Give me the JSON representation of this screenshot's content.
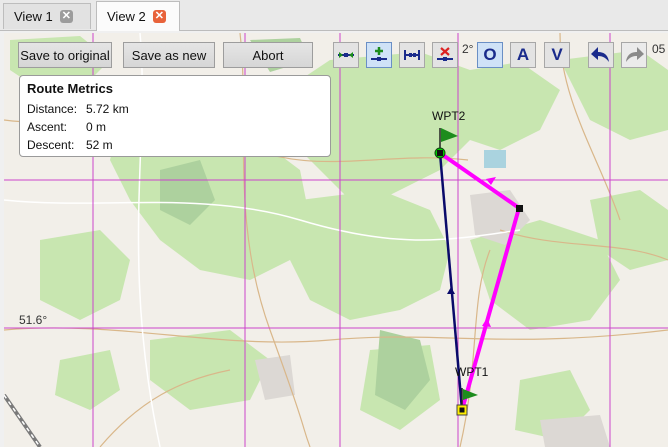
{
  "tabs": [
    {
      "label": "View 1",
      "close_icon": "close-icon"
    },
    {
      "label": "View 2",
      "close_icon": "close-icon"
    }
  ],
  "toolbar": {
    "save_original": "Save to original",
    "save_new": "Save as new",
    "abort": "Abort",
    "tools": [
      {
        "name": "move-points-icon"
      },
      {
        "name": "add-point-icon"
      },
      {
        "name": "insert-points-icon"
      },
      {
        "name": "delete-point-icon"
      },
      {
        "name": "mode-o",
        "label": "O"
      },
      {
        "name": "mode-a",
        "label": "A"
      },
      {
        "name": "mode-v",
        "label": "V"
      },
      {
        "name": "undo-icon"
      },
      {
        "name": "redo-icon"
      }
    ]
  },
  "metrics": {
    "title": "Route Metrics",
    "distance_label": "Distance:",
    "distance_value": "5.72 km",
    "ascent_label": "Ascent:",
    "ascent_value": "0 m",
    "descent_label": "Descent:",
    "descent_value": "52 m"
  },
  "map": {
    "grid_labels": {
      "lon1": "2°",
      "lon2": "05",
      "lat": "51.6°"
    },
    "waypoints": [
      {
        "name": "WPT2"
      },
      {
        "name": "WPT1"
      }
    ],
    "colors": {
      "route_edit": "#ff00ff",
      "route_original": "#0a0a6a",
      "grid": "#cc44cc"
    }
  }
}
